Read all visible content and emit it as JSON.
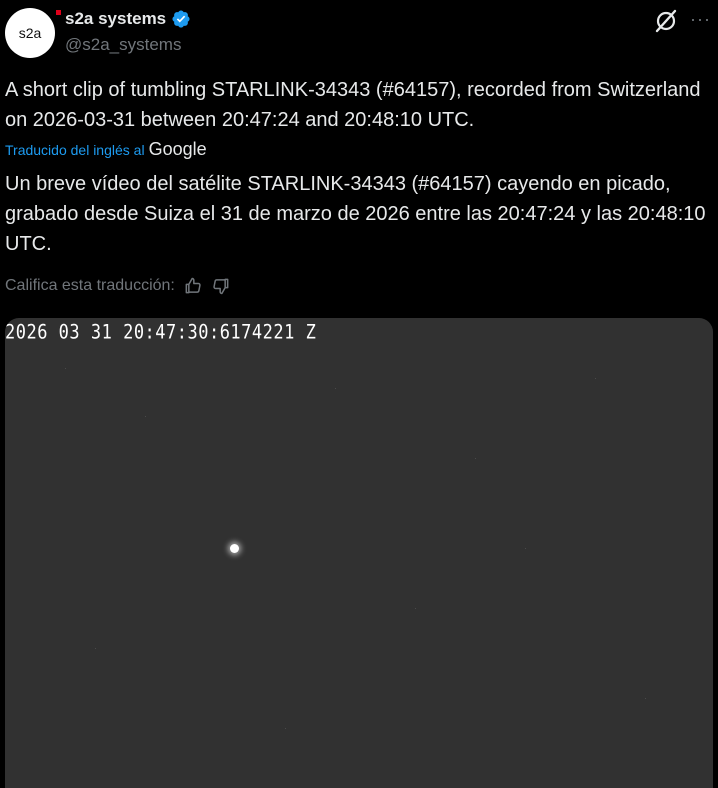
{
  "author": {
    "display_name": "s2a systems",
    "handle": "@s2a_systems",
    "avatar_text": "s2a",
    "verified": true,
    "verified_color": "#1d9bf0"
  },
  "header_actions": {
    "grok_icon": "grok-icon",
    "more_icon": "more-icon",
    "more_label": "···"
  },
  "tweet": {
    "text": "A short clip of tumbling STARLINK-34343 (#64157), recorded from Switzerland on 2026-03-31 between 20:47:24 and 20:48:10 UTC."
  },
  "translation": {
    "label": "Traducido del inglés al",
    "provider": "Google",
    "text": "Un breve vídeo del satélite STARLINK-34343 (#64157) cayendo en picado, grabado desde Suiza el 31 de marzo de 2026 entre las 20:47:24 y las 20:48:10 UTC.",
    "rate_label": "Califica esta traducción:"
  },
  "media": {
    "timestamp_overlay": "2026 03 31 20:47:30:6174221 Z",
    "background_color": "#313131"
  },
  "colors": {
    "background": "#000000",
    "text_primary": "#e7e9ea",
    "text_secondary": "#71767b",
    "link": "#1d9bf0"
  }
}
